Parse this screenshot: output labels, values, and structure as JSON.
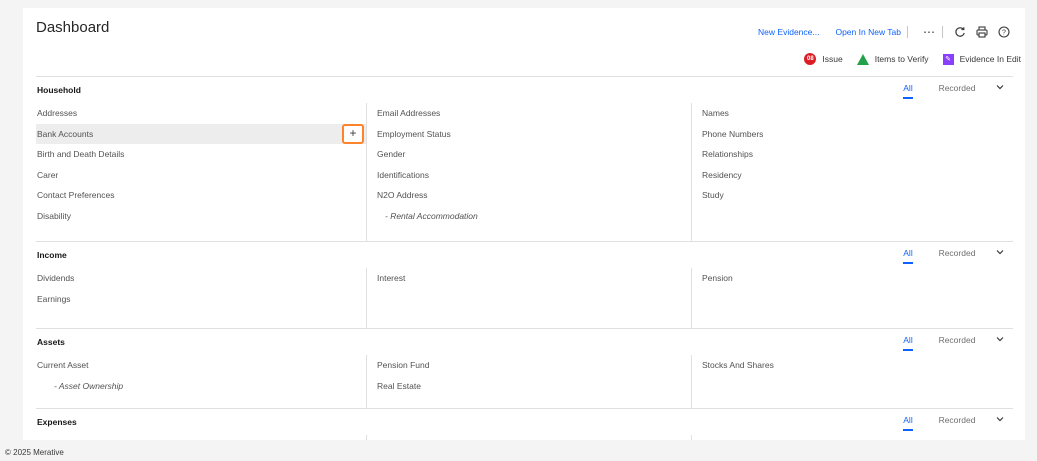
{
  "page": {
    "title": "Dashboard"
  },
  "top_actions": {
    "new_evidence": "New Evidence...",
    "open_new_tab": "Open In New Tab",
    "more_icon": "overflow-menu-icon",
    "refresh_icon": "refresh-icon",
    "print_icon": "print-icon",
    "help_icon": "help-icon"
  },
  "legend": {
    "issue": "Issue",
    "issue_badge": "08",
    "items_to_verify": "Items to Verify",
    "evidence_in_edit": "Evidence In Edit"
  },
  "colors": {
    "accent": "#0f62fe",
    "issue": "#da1e28",
    "verify": "#24a148",
    "edit": "#8a3ffc",
    "focus": "#ff832b"
  },
  "tabs": {
    "all": "All",
    "recorded": "Recorded"
  },
  "sections": [
    {
      "title": "Household",
      "col1": [
        {
          "label": "Addresses"
        },
        {
          "label": "Bank Accounts",
          "hover": true,
          "add": "+"
        },
        {
          "label": "Birth and Death Details"
        },
        {
          "label": "Carer"
        },
        {
          "label": "Contact Preferences"
        },
        {
          "label": "Disability"
        }
      ],
      "col2": [
        {
          "label": "Email Addresses"
        },
        {
          "label": "Employment Status"
        },
        {
          "label": "Gender"
        },
        {
          "label": "Identifications"
        },
        {
          "label": "N2O Address"
        },
        {
          "label": "- Rental Accommodation",
          "sub": true
        }
      ],
      "col3": [
        {
          "label": "Names"
        },
        {
          "label": "Phone Numbers"
        },
        {
          "label": "Relationships"
        },
        {
          "label": "Residency"
        },
        {
          "label": "Study"
        }
      ]
    },
    {
      "title": "Income",
      "col1": [
        {
          "label": "Dividends"
        },
        {
          "label": "Earnings"
        }
      ],
      "col2": [
        {
          "label": "Interest"
        }
      ],
      "col3": [
        {
          "label": "Pension"
        }
      ]
    },
    {
      "title": "Assets",
      "col1": [
        {
          "label": "Current Asset"
        },
        {
          "label": "- Asset Ownership",
          "sub": true
        }
      ],
      "col2": [
        {
          "label": "Pension Fund"
        },
        {
          "label": "Real Estate"
        }
      ],
      "col3": [
        {
          "label": "Stocks And Shares"
        }
      ]
    },
    {
      "title": "Expenses",
      "col1": [],
      "col2": [],
      "col3": []
    }
  ],
  "footer": "© 2025 Merative"
}
